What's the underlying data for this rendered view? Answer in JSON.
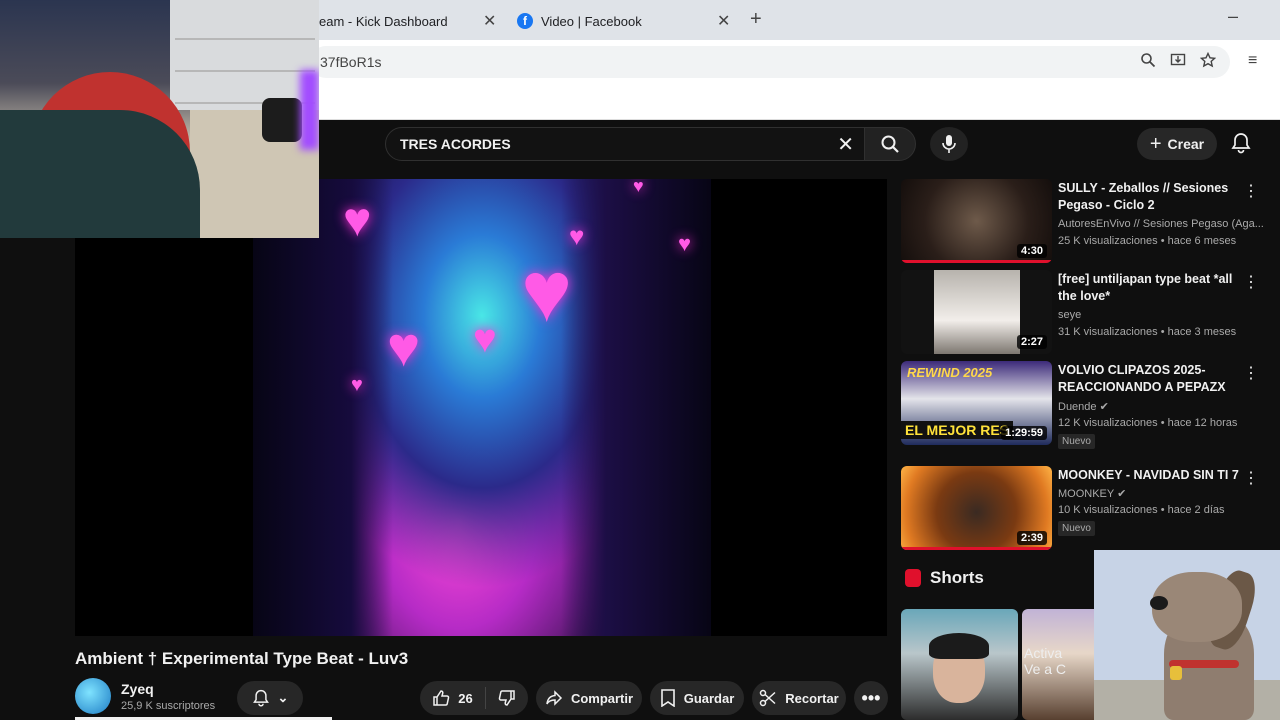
{
  "browser": {
    "tabs": [
      {
        "label": "eam - Kick Dashboard"
      },
      {
        "label": "Video | Facebook",
        "icon": "facebook-icon"
      }
    ],
    "new_tab_label": "+",
    "minimize_label": "–",
    "address_text": "37fBoR1s"
  },
  "youtube": {
    "search": {
      "value": "TRES ACORDES"
    },
    "create_label": "Crear",
    "video": {
      "title": "Ambient † Experimental Type Beat - Luv3",
      "channel_name": "Zyeq",
      "subscribers": "25,9 K suscriptores",
      "likes": "26",
      "share_label": "Compartir",
      "save_label": "Guardar",
      "clip_label": "Recortar"
    },
    "recommendations": [
      {
        "title": "SULLY - Zeballos // Sesiones Pegaso - Ciclo 2",
        "channel": "AutoresEnVivo // Sesiones Pegaso (Aga...",
        "meta": "25 K visualizaciones • hace 6 meses",
        "duration": "4:30",
        "badge": ""
      },
      {
        "title": "[free] untiljapan type beat *all the love*",
        "channel": "seye",
        "meta": "31 K visualizaciones • hace 3 meses",
        "duration": "2:27",
        "badge": ""
      },
      {
        "title": "VOLVIO CLIPAZOS 2025-REACCIONANDO A PEPAZX",
        "channel": "Duende",
        "meta": "12 K visualizaciones • hace 12 horas",
        "duration": "1:29:59",
        "badge": "Nuevo",
        "thumb_text_top": "REWIND 2025",
        "thumb_text_bottom": "EL MEJOR RES"
      },
      {
        "title": "MOONKEY - NAVIDAD SIN TI 7",
        "channel": "MOONKEY",
        "meta": "10 K visualizaciones • hace 2 días",
        "duration": "2:39",
        "badge": "Nuevo"
      }
    ],
    "shorts_title": "Shorts",
    "short_overlay_text": "Activa\nVe a C"
  },
  "colors": {
    "yt_bg": "#0f0f0f",
    "chip_bg": "#272727",
    "accent_red": "#e0102c",
    "facebook_blue": "#1877f2"
  }
}
